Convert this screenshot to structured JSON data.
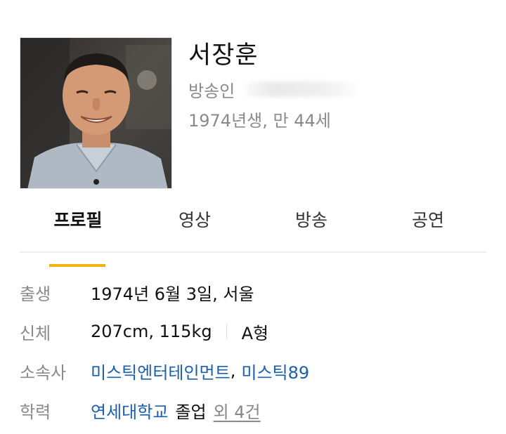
{
  "profile": {
    "name": "서장훈",
    "job": "방송인",
    "age": "1974년생, 만 44세",
    "photo_icon": "person-photo"
  },
  "tabs": [
    {
      "label": "프로필",
      "active": true
    },
    {
      "label": "영상",
      "active": false
    },
    {
      "label": "방송",
      "active": false
    },
    {
      "label": "공연",
      "active": false
    }
  ],
  "info": {
    "birth": {
      "label": "출생",
      "value": "1974년 6월 3일, 서울"
    },
    "body": {
      "label": "신체",
      "value": "207cm, 115kg",
      "blood": "A형"
    },
    "agency": {
      "label": "소속사",
      "agency1": "미스틱엔터테인먼트",
      "separator": ",",
      "agency2": "미스틱89"
    },
    "education": {
      "label": "학력",
      "school": "연세대학교",
      "status": "졸업",
      "more": "외 4건"
    }
  },
  "colors": {
    "accent": "#f2b212",
    "link": "#1a5fb0",
    "muted": "#8a8a8a"
  }
}
